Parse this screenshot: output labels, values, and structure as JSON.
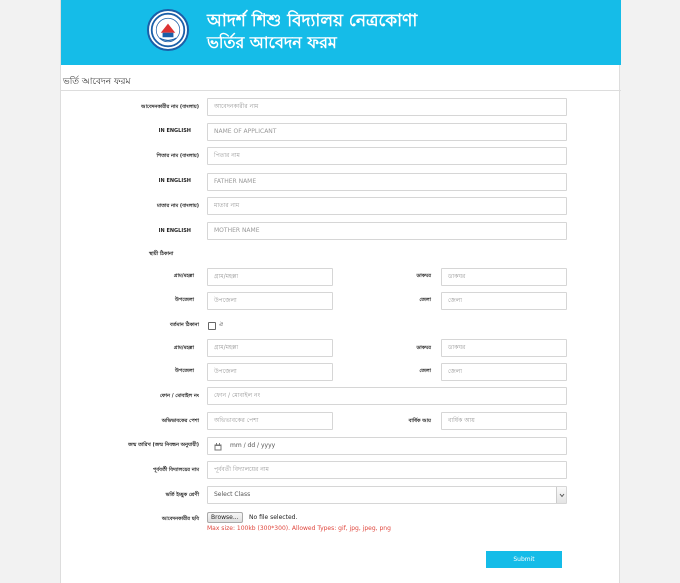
{
  "header": {
    "school_name": "আদর্শ শিশু বিদ্যালয় নেত্রকোণা",
    "form_name": "ভর্তির আবেদন ফরম",
    "logo": "school-crest-icon",
    "background": "#15bce8"
  },
  "form": {
    "title": "ভর্তি আবেদন ফরম",
    "applicant_bn": {
      "label": "আবেদনকারীর নাম (বাংলায়)",
      "placeholder": "আবেদনকারীর নাম"
    },
    "applicant_en": {
      "label": "IN ENGLISH",
      "placeholder": "NAME OF APPLICANT"
    },
    "father_bn": {
      "label": "পিতার নাম (বাংলায়)",
      "placeholder": "পিতার নাম"
    },
    "father_en": {
      "label": "IN ENGLISH",
      "placeholder": "FATHER NAME"
    },
    "mother_bn": {
      "label": "মাতার নাম (বাংলায়)",
      "placeholder": "মাতার নাম"
    },
    "mother_en": {
      "label": "IN ENGLISH",
      "placeholder": "MOTHER NAME"
    },
    "permanent_address": {
      "label": "স্থায়ী ঠিকানা",
      "village_label": "গ্রাম/মহল্লা",
      "village_placeholder": "গ্রাম/মহল্লা",
      "post_label": "ডাকঘর",
      "post_placeholder": "ডাকঘর",
      "upazila_label": "উপজেলা",
      "upazila_placeholder": "উপজেলা",
      "district_label": "জেলা",
      "district_placeholder": "জেলা"
    },
    "present_address": {
      "label": "বর্তমান ঠিকানা",
      "same_checkbox_label": "ঐ",
      "same_checked": false,
      "village_label": "গ্রাম/মহল্লা",
      "village_placeholder": "গ্রাম/মহল্লা",
      "post_label": "ডাকঘর",
      "post_placeholder": "ডাকঘর",
      "upazila_label": "উপজেলা",
      "upazila_placeholder": "উপজেলা",
      "district_label": "জেলা",
      "district_placeholder": "জেলা"
    },
    "phone": {
      "label": "ফোন / মোবাইল নং",
      "placeholder": "ফোন / মোবাইল নং"
    },
    "guardian_occupation": {
      "label": "অভিভাবকের পেশা",
      "placeholder": "অভিভাবকের পেশা"
    },
    "annual_income": {
      "label": "বার্ষিক আয়",
      "placeholder": "বার্ষিক আয়"
    },
    "birth_date": {
      "label": "জন্ম তারিখ (জন্ম নিবন্ধন অনুযায়ী)",
      "placeholder": "mm / dd / yyyy",
      "icon": "calendar-icon"
    },
    "previous_school": {
      "label": "পূর্ববর্তী বিদ্যালয়ের নাম",
      "placeholder": "পূর্ববর্তী বিদ্যালয়ের নাম"
    },
    "class": {
      "label": "ভর্তি ইচ্ছুক শ্রেণী",
      "selected": "Select Class"
    },
    "photo": {
      "label": "আবেদনকারীর ছবি",
      "button": "Browse...",
      "status": "No file selected.",
      "hint": "Max size: 100kb (300*300). Allowed Types: gif, jpg, jpeg, png"
    },
    "submit": "Submit"
  }
}
